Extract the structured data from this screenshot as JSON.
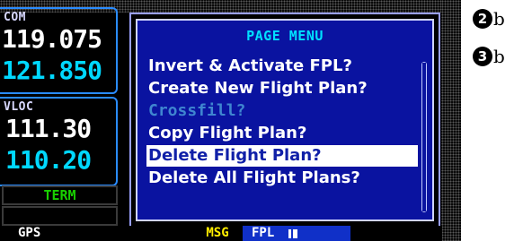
{
  "radio": {
    "com_label": "COM",
    "com_active": "119.075",
    "com_standby": "121.850",
    "vloc_label": "VLOC",
    "vloc_active": "111.30",
    "vloc_standby": "110.20",
    "term_label": "TERM"
  },
  "menu": {
    "title": "PAGE MENU",
    "items": [
      {
        "label": "Invert & Activate FPL?",
        "state": "enabled"
      },
      {
        "label": "Create New Flight Plan?",
        "state": "enabled"
      },
      {
        "label": "Crossfill?",
        "state": "disabled"
      },
      {
        "label": "Copy Flight Plan?",
        "state": "enabled"
      },
      {
        "label": "Delete Flight Plan?",
        "state": "selected"
      },
      {
        "label": "Delete All Flight Plans?",
        "state": "enabled"
      }
    ]
  },
  "status_bar": {
    "mode": "GPS",
    "msg": "MSG",
    "page_group": "FPL"
  },
  "callouts": [
    {
      "number": "2",
      "letter": "b"
    },
    {
      "number": "3",
      "letter": "b"
    }
  ],
  "colors": {
    "menu_background": "#0a13a0",
    "selected_highlight": "#ffffff",
    "title_cyan": "#00e0ff",
    "active_freq_white": "#ffffff",
    "standby_freq_cyan": "#00d8ff",
    "term_green": "#19d000",
    "msg_yellow": "#ffee00",
    "disabled_item_blue": "#3f86d0"
  }
}
